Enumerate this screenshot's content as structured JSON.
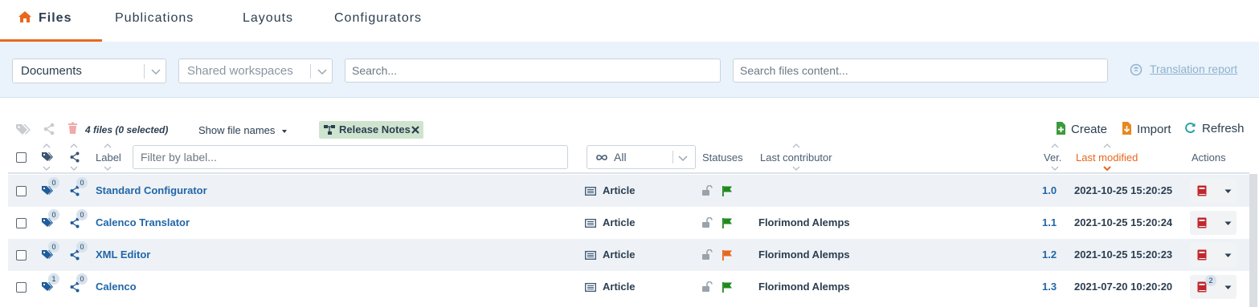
{
  "tabs": [
    {
      "label": "Files",
      "active": true,
      "icon": "home-icon"
    },
    {
      "label": "Publications",
      "active": false
    },
    {
      "label": "Layouts",
      "active": false
    },
    {
      "label": "Configurators",
      "active": false
    }
  ],
  "filters": {
    "type_select": "Documents",
    "workspace_select_placeholder": "Shared workspaces",
    "search_placeholder": "Search...",
    "content_search_placeholder": "Search files content...",
    "translation_report": "Translation report"
  },
  "toolbar": {
    "file_count": "4 files (0 selected)",
    "show_file_names": "Show file names",
    "active_tag": "Release Notes",
    "create": "Create",
    "import": "Import",
    "refresh": "Refresh"
  },
  "table": {
    "headers": {
      "label": "Label",
      "label_filter_placeholder": "Filter by label...",
      "status_select": "All",
      "statuses": "Statuses",
      "last_contributor": "Last contributor",
      "version": "Ver.",
      "last_modified": "Last modified",
      "actions": "Actions"
    },
    "rows": [
      {
        "tags": "0",
        "shares": "0",
        "label": "Standard Configurator",
        "type": "Article",
        "flag_color": "#1f8a1f",
        "contributor": "",
        "version": "1.0",
        "modified": "2021-10-25 15:20:25",
        "action_badge": ""
      },
      {
        "tags": "0",
        "shares": "0",
        "label": "Calenco Translator",
        "type": "Article",
        "flag_color": "#1f8a1f",
        "contributor": "Florimond Alemps",
        "version": "1.1",
        "modified": "2021-10-25 15:20:24",
        "action_badge": ""
      },
      {
        "tags": "0",
        "shares": "0",
        "label": "XML Editor",
        "type": "Article",
        "flag_color": "#e8671e",
        "contributor": "Florimond Alemps",
        "version": "1.2",
        "modified": "2021-10-25 15:20:23",
        "action_badge": ""
      },
      {
        "tags": "1",
        "shares": "0",
        "label": "Calenco",
        "type": "Article",
        "flag_color": "#1f8a1f",
        "contributor": "Florimond Alemps",
        "version": "1.3",
        "modified": "2021-07-20 10:20:20",
        "action_badge": "2"
      }
    ]
  },
  "colors": {
    "accent": "#e8671e",
    "link": "#2266a8",
    "filter_bar_bg": "#eaf3fb"
  }
}
